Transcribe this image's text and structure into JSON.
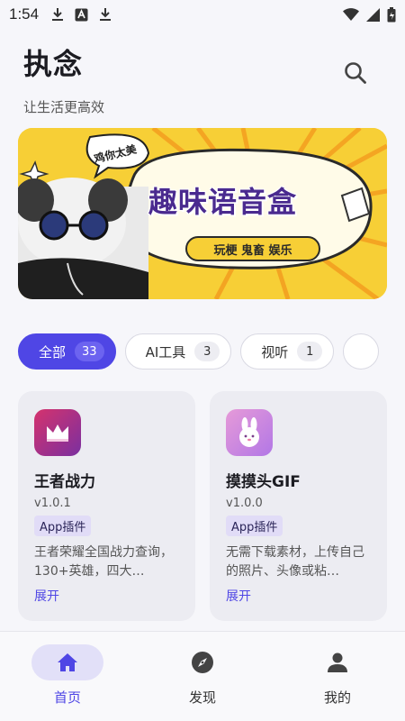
{
  "status_bar": {
    "time": "1:54"
  },
  "header": {
    "title": "执念",
    "subtitle": "让生活更高效"
  },
  "banner": {
    "title": "趣味语音盒",
    "subtitle": "玩梗 鬼畜 娱乐",
    "bubble": "鸡你太美"
  },
  "chips": [
    {
      "label": "全部",
      "count": "33"
    },
    {
      "label": "AI工具",
      "count": "3"
    },
    {
      "label": "视听",
      "count": "1"
    }
  ],
  "cards": [
    {
      "name": "王者战力",
      "version": "v1.0.1",
      "tag": "App插件",
      "description": "王者荣耀全国战力查询，130+英雄，四大…",
      "expand": "展开",
      "icon": "crown-icon",
      "icon_color": "#c02a72"
    },
    {
      "name": "摸摸头GIF",
      "version": "v1.0.0",
      "tag": "App插件",
      "description": "无需下载素材，上传自己的照片、头像或粘…",
      "expand": "展开",
      "icon": "bunny-icon",
      "icon_color": "#c983e8"
    }
  ],
  "nav": [
    {
      "label": "首页",
      "icon": "home-icon"
    },
    {
      "label": "发现",
      "icon": "compass-icon"
    },
    {
      "label": "我的",
      "icon": "person-icon"
    }
  ],
  "colors": {
    "accent": "#4f46e5",
    "background": "#f6f6fa"
  }
}
